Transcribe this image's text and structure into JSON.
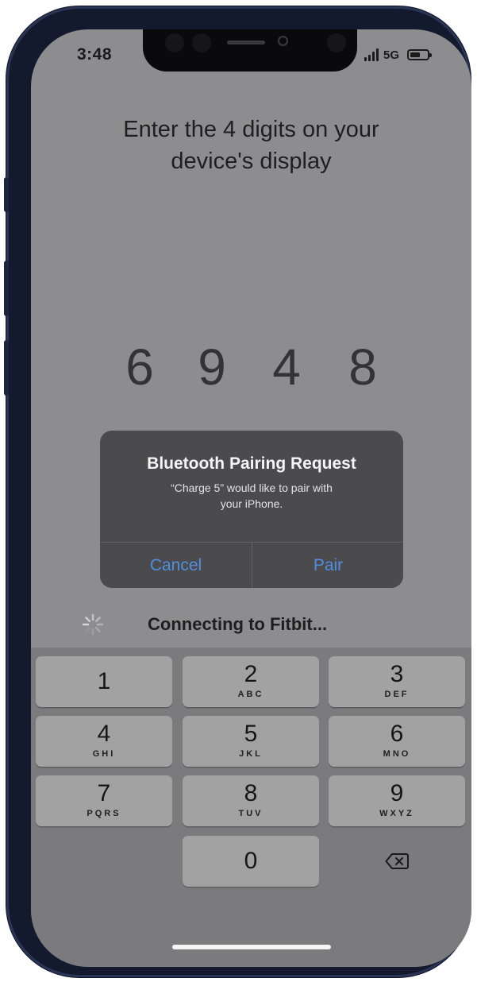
{
  "status_bar": {
    "time": "3:48",
    "network": "5G",
    "icons": [
      "signal-icon",
      "battery-icon"
    ]
  },
  "heading": {
    "line1": "Enter the 4 digits on your",
    "line2": "device's display"
  },
  "code": [
    "6",
    "9",
    "4",
    "8"
  ],
  "alert": {
    "title": "Bluetooth Pairing Request",
    "message_line1": "“Charge 5” would like to pair with",
    "message_line2": "your iPhone.",
    "cancel_label": "Cancel",
    "pair_label": "Pair",
    "button_color": "#4f8fe0"
  },
  "connecting": {
    "label": "Connecting to Fitbit...",
    "icon": "spinner-icon"
  },
  "keypad": {
    "keys": [
      {
        "digit": "1",
        "letters": ""
      },
      {
        "digit": "2",
        "letters": "ABC"
      },
      {
        "digit": "3",
        "letters": "DEF"
      },
      {
        "digit": "4",
        "letters": "GHI"
      },
      {
        "digit": "5",
        "letters": "JKL"
      },
      {
        "digit": "6",
        "letters": "MNO"
      },
      {
        "digit": "7",
        "letters": "PQRS"
      },
      {
        "digit": "8",
        "letters": "TUV"
      },
      {
        "digit": "9",
        "letters": "WXYZ"
      },
      {
        "digit": "0",
        "letters": ""
      }
    ],
    "delete_icon": "backspace-icon"
  },
  "colors": {
    "screen_dim": "#8d8d8f",
    "alert_bg": "#4b4b4d",
    "frame": "#141a2e"
  }
}
